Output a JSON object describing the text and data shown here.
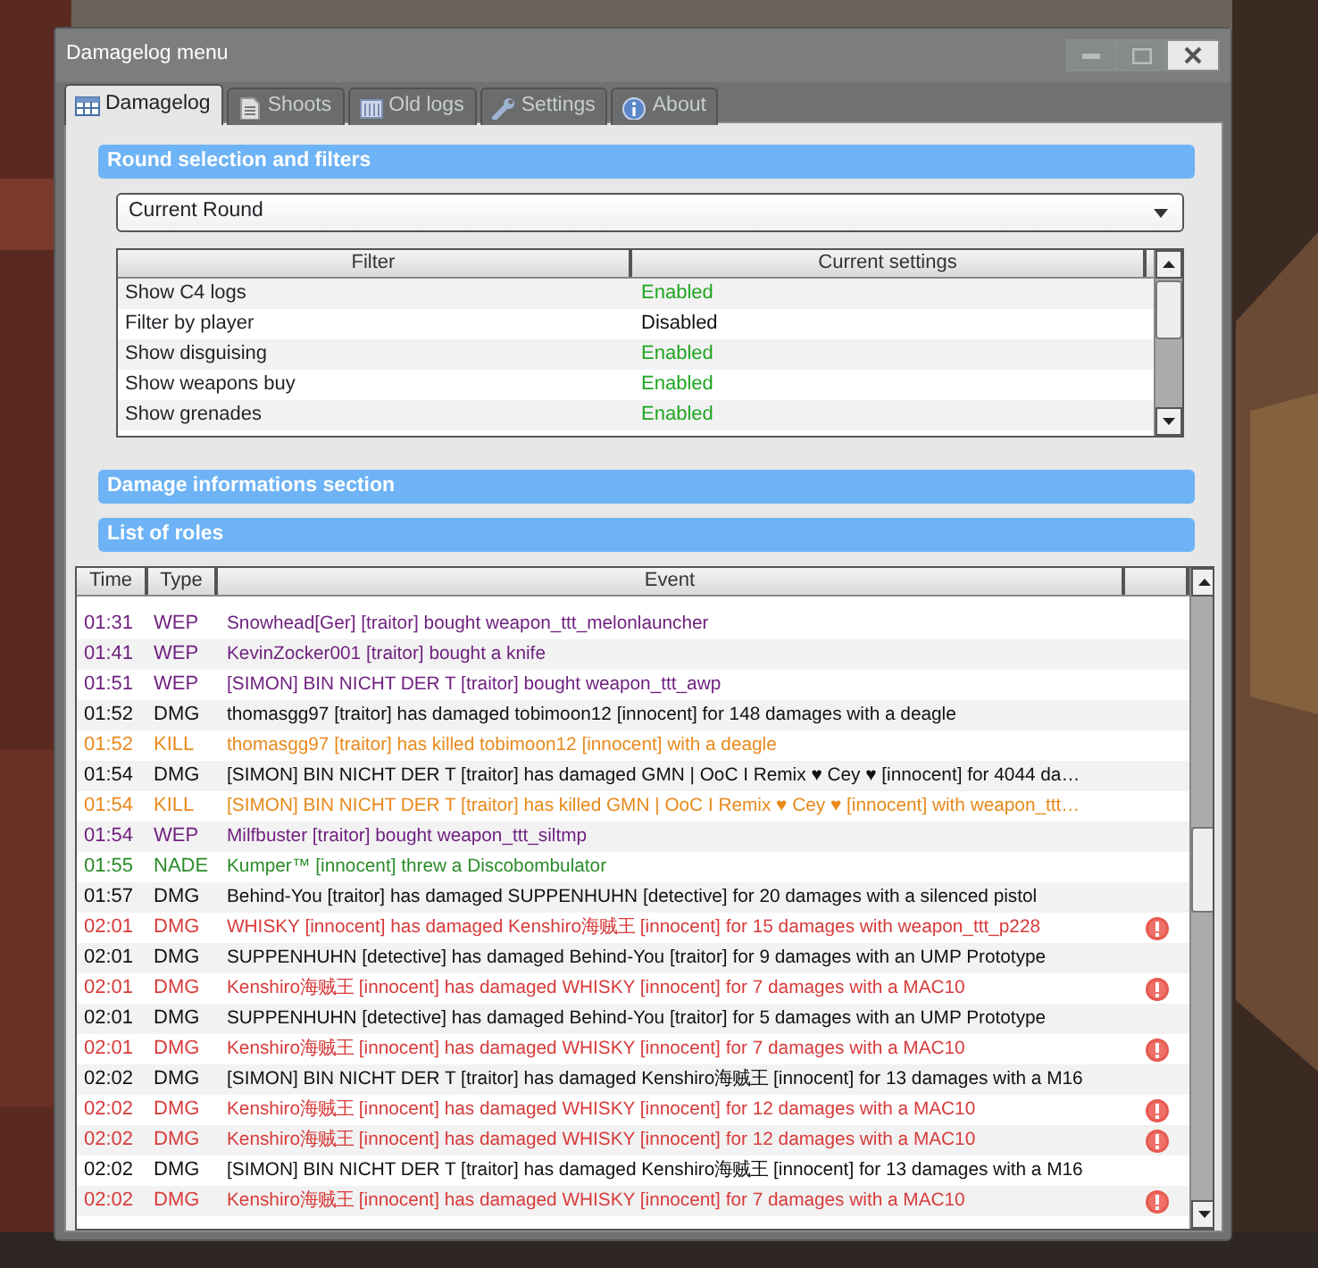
{
  "window": {
    "title": "Damagelog menu"
  },
  "tabs": [
    {
      "label": "Damagelog",
      "selected": true
    },
    {
      "label": "Shoots",
      "selected": false
    },
    {
      "label": "Old logs",
      "selected": false
    },
    {
      "label": "Settings",
      "selected": false
    },
    {
      "label": "About",
      "selected": false
    }
  ],
  "sections": [
    {
      "title": "Round selection and filters"
    },
    {
      "title": "Damage informations section"
    },
    {
      "title": "List of roles"
    }
  ],
  "round_select": {
    "value": "Current Round"
  },
  "filters": {
    "columns": [
      "Filter",
      "Current settings"
    ],
    "rows": [
      {
        "filter": "Show C4 logs",
        "setting": "Enabled",
        "enabled": true
      },
      {
        "filter": "Filter by player",
        "setting": "Disabled",
        "enabled": false
      },
      {
        "filter": "Show disguising",
        "setting": "Enabled",
        "enabled": true
      },
      {
        "filter": "Show weapons buy",
        "setting": "Enabled",
        "enabled": true
      },
      {
        "filter": "Show grenades",
        "setting": "Enabled",
        "enabled": true
      }
    ]
  },
  "log": {
    "columns": [
      "Time",
      "Type",
      "Event"
    ],
    "rows": [
      {
        "time": "01:31",
        "type": "WEP",
        "event": "Snowhead[Ger] [traitor] bought weapon_ttt_melonlauncher",
        "kind": "wep",
        "flagged": false
      },
      {
        "time": "01:41",
        "type": "WEP",
        "event": "KevinZocker001 [traitor] bought a knife",
        "kind": "wep",
        "flagged": false
      },
      {
        "time": "01:51",
        "type": "WEP",
        "event": "[SIMON] BIN NICHT DER T [traitor] bought weapon_ttt_awp",
        "kind": "wep",
        "flagged": false
      },
      {
        "time": "01:52",
        "type": "DMG",
        "event": "thomasgg97 [traitor] has damaged tobimoon12 [innocent] for 148 damages with a deagle",
        "kind": "dmg",
        "flagged": false
      },
      {
        "time": "01:52",
        "type": "KILL",
        "event": "thomasgg97 [traitor] has killed tobimoon12 [innocent] with a deagle",
        "kind": "kill",
        "flagged": false
      },
      {
        "time": "01:54",
        "type": "DMG",
        "event": "[SIMON] BIN NICHT DER T [traitor] has damaged GMN | OoC I Remix ♥ Cey ♥ [innocent] for 4044 da…",
        "kind": "dmg",
        "flagged": false
      },
      {
        "time": "01:54",
        "type": "KILL",
        "event": "[SIMON] BIN NICHT DER T [traitor] has killed GMN | OoC I Remix ♥ Cey ♥ [innocent] with weapon_ttt…",
        "kind": "kill",
        "flagged": false
      },
      {
        "time": "01:54",
        "type": "WEP",
        "event": "Milfbuster [traitor] bought weapon_ttt_siltmp",
        "kind": "wep",
        "flagged": false
      },
      {
        "time": "01:55",
        "type": "NADE",
        "event": "Kumper™ [innocent] threw a Discobombulator",
        "kind": "nade",
        "flagged": false
      },
      {
        "time": "01:57",
        "type": "DMG",
        "event": "Behind-You [traitor] has damaged SUPPENHUHN [detective] for 20 damages with a silenced pistol",
        "kind": "dmg",
        "flagged": false
      },
      {
        "time": "02:01",
        "type": "DMG",
        "event": "WHISKY [innocent] has damaged Kenshiro海贼王 [innocent] for 15 damages with weapon_ttt_p228",
        "kind": "team",
        "flagged": true
      },
      {
        "time": "02:01",
        "type": "DMG",
        "event": "SUPPENHUHN [detective] has damaged Behind-You [traitor] for 9 damages with an UMP Prototype",
        "kind": "dmg",
        "flagged": false
      },
      {
        "time": "02:01",
        "type": "DMG",
        "event": "Kenshiro海贼王 [innocent] has damaged WHISKY [innocent] for 7 damages with a MAC10",
        "kind": "team",
        "flagged": true
      },
      {
        "time": "02:01",
        "type": "DMG",
        "event": "SUPPENHUHN [detective] has damaged Behind-You [traitor] for 5 damages with an UMP Prototype",
        "kind": "dmg",
        "flagged": false
      },
      {
        "time": "02:01",
        "type": "DMG",
        "event": "Kenshiro海贼王 [innocent] has damaged WHISKY [innocent] for 7 damages with a MAC10",
        "kind": "team",
        "flagged": true
      },
      {
        "time": "02:02",
        "type": "DMG",
        "event": "[SIMON] BIN NICHT DER T [traitor] has damaged Kenshiro海贼王 [innocent] for 13 damages with a M16",
        "kind": "dmg",
        "flagged": false
      },
      {
        "time": "02:02",
        "type": "DMG",
        "event": "Kenshiro海贼王 [innocent] has damaged WHISKY [innocent] for 12 damages with a MAC10",
        "kind": "team",
        "flagged": true
      },
      {
        "time": "02:02",
        "type": "DMG",
        "event": "Kenshiro海贼王 [innocent] has damaged WHISKY [innocent] for 12 damages with a MAC10",
        "kind": "team",
        "flagged": true
      },
      {
        "time": "02:02",
        "type": "DMG",
        "event": "[SIMON] BIN NICHT DER T [traitor] has damaged Kenshiro海贼王 [innocent] for 13 damages with a M16",
        "kind": "dmg",
        "flagged": false
      },
      {
        "time": "02:02",
        "type": "DMG",
        "event": "Kenshiro海贼王 [innocent] has damaged WHISKY [innocent] for 7 damages with a MAC10",
        "kind": "team",
        "flagged": true
      }
    ]
  }
}
